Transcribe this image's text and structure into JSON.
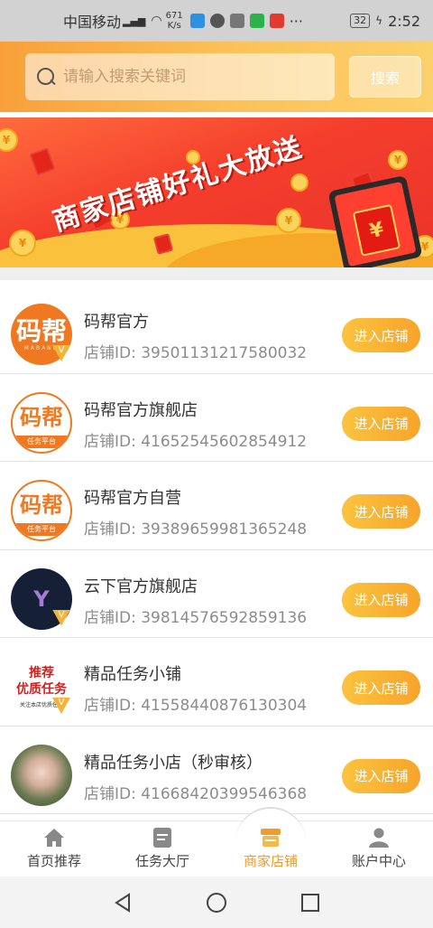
{
  "status_bar": {
    "carrier": "中国移动",
    "network_speed": "671",
    "network_unit": "K/s",
    "battery": "32",
    "time": "2:52",
    "more": "···"
  },
  "search": {
    "placeholder": "请输入搜索关键词",
    "button_label": "搜索"
  },
  "banner": {
    "title": "商家店铺好礼大放送"
  },
  "stores": [
    {
      "name": "码帮官方",
      "store_id": "店铺ID: 3950113121758003​2",
      "avatar": "orange",
      "button_label": "进入店铺"
    },
    {
      "name": "码帮官方旗舰店",
      "store_id": "店铺ID: 41652545602854912",
      "avatar": "white",
      "button_label": "进入店铺"
    },
    {
      "name": "码帮官方自营",
      "store_id": "店铺ID: 39389659981365248",
      "avatar": "white",
      "button_label": "进入店铺"
    },
    {
      "name": "云下官方旗舰店",
      "store_id": "店铺ID: 39814576592859136",
      "avatar": "navy",
      "button_label": "进入店铺"
    },
    {
      "name": "精品任务小铺",
      "store_id": "店铺ID: 41558440876130304",
      "avatar": "text",
      "button_label": "进入店铺"
    },
    {
      "name": "精品任务小店（秒审核）",
      "store_id": "店铺ID: 41668420399546368",
      "avatar": "photo",
      "button_label": "进入店铺"
    }
  ],
  "avatars": {
    "logo_text": "码帮",
    "logo_sub": "MABANG",
    "strip_text": "任务平台",
    "badge": "V",
    "navy_logo": "Y",
    "text_line1": "推荐",
    "text_line2": "优质任务",
    "text_line3": "关注本店优质任务"
  },
  "tabs": [
    {
      "label": "首页推荐",
      "icon": "home-icon"
    },
    {
      "label": "任务大厅",
      "icon": "task-hall-icon"
    },
    {
      "label": "商家店铺",
      "icon": "store-icon",
      "active": true
    },
    {
      "label": "账户中心",
      "icon": "account-icon"
    }
  ],
  "colors": {
    "accent": "#f39a2a",
    "button": "#fbb53a",
    "header_start": "#f9a03a",
    "header_end": "#fcd06a"
  }
}
